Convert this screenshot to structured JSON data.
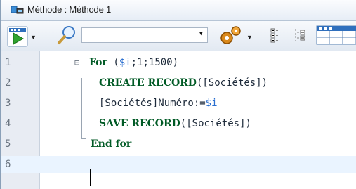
{
  "window": {
    "title": "Méthode : Méthode 1"
  },
  "toolbar": {
    "search_value": "",
    "buttons": [
      "run-icon",
      "search-icon",
      "gear-menu-icon",
      "collapse-all-icon",
      "expand-all-icon",
      "panel-icon"
    ]
  },
  "editor": {
    "lines": [
      {
        "number": "1",
        "fold": "⊟",
        "tokens": [
          {
            "t": "kw",
            "v": "For"
          },
          {
            "t": "plain",
            "v": " ("
          },
          {
            "t": "var",
            "v": "$i"
          },
          {
            "t": "plain",
            "v": ";1;1500)"
          }
        ]
      },
      {
        "number": "2",
        "tokens": [
          {
            "t": "kw",
            "v": "CREATE RECORD"
          },
          {
            "t": "plain",
            "v": "([Sociétés])"
          }
        ]
      },
      {
        "number": "3",
        "tokens": [
          {
            "t": "plain",
            "v": "[Sociétés]Numéro:="
          },
          {
            "t": "var",
            "v": "$i"
          }
        ]
      },
      {
        "number": "4",
        "tokens": [
          {
            "t": "kw",
            "v": "SAVE RECORD"
          },
          {
            "t": "plain",
            "v": "([Sociétés])"
          }
        ]
      },
      {
        "number": "5",
        "tokens": [
          {
            "t": "kw",
            "v": "End for"
          }
        ]
      },
      {
        "number": "6",
        "tokens": []
      }
    ],
    "current_line": "6"
  },
  "colors": {
    "keyword": "#005a25",
    "variable": "#2a6fd0",
    "gutter": "#e8ecf3",
    "titlebar": "#e6edf6"
  }
}
